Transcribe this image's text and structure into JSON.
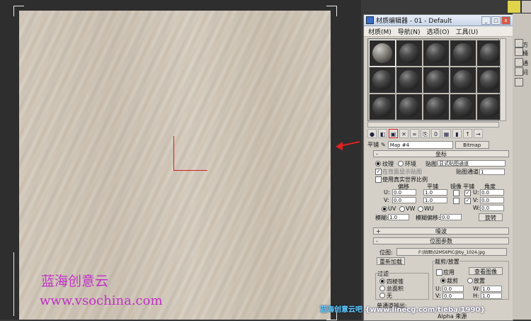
{
  "viewport": {},
  "watermark": {
    "line1": "蓝海创意云",
    "line2": "www.vsochina.com"
  },
  "credit": {
    "text": "蓝海创意云吧",
    "url": "{www.linecg.com/tieba/1990}"
  },
  "window": {
    "title": "材质编辑器 - 01 - Default",
    "minimize": "_",
    "maximize": "□",
    "close": "x"
  },
  "menu": [
    "材质(M)",
    "导航(N)",
    "选项(O)",
    "工具(U)"
  ],
  "toolbar": {
    "icons": [
      "get-material",
      "put-to-scene",
      "assign-to-selection",
      "reset",
      "make-unique",
      "put-library",
      "material-id",
      "show-map",
      "show-end-result",
      "go-parent",
      "go-sibling"
    ],
    "delete_glyph": "✕"
  },
  "map_row": {
    "label": "平铺",
    "map_name": "Map #4",
    "type_button": "Bitmap"
  },
  "coords": {
    "header": "坐标",
    "texture": "纹理",
    "environ": "环境",
    "mapping_label": "贴图:",
    "mapping_value": "显式贴图通道",
    "show_map_back": "在背面显示贴图",
    "map_channel_label": "贴图通道:",
    "map_channel_value": "1",
    "real_world": "使用真实世界比例",
    "offset": "偏移",
    "tiling": "平铺",
    "mirror": "镜像",
    "tile": "平铺",
    "angle": "角度",
    "u_label": "U:",
    "v_label": "V:",
    "w_label": "W:",
    "u_offset": "0.0",
    "v_offset": "0.0",
    "u_tiling": "1.0",
    "v_tiling": "1.0",
    "u_angle": "0.0",
    "v_angle": "0.0",
    "w_angle": "0.0",
    "uv": "UV",
    "vw": "VW",
    "wu": "WU",
    "blur_label": "模糊:",
    "blur_value": "1.0",
    "blur_offset_label": "模糊偏移:",
    "blur_offset_value": "0.0",
    "rotate": "旋转"
  },
  "noise": {
    "header": "噪波"
  },
  "bitmap_params": {
    "header": "位图参数",
    "bitmap_label": "位图:",
    "bitmap_path": "F:\\贴图\\02M56PIC@by_1024.jpg",
    "reload": "重新加载",
    "crop_group": "裁剪/放置",
    "apply": "应用",
    "view_image": "查看图像",
    "crop": "裁剪",
    "place": "放置",
    "filter_group": "过滤",
    "pyramidal": "四棱锥",
    "summed_area": "总面积",
    "none": "无",
    "u_label": "U:",
    "v_label": "V:",
    "w_label": "W:",
    "h_label": "H:",
    "u_value": "0.0",
    "v_value": "0.0",
    "w_value": "1.0",
    "h_value": "1.0",
    "mono_output": "单通道输出:",
    "alpha_group": "Alpha 来源"
  },
  "right_strip": {
    "labels": [
      "方",
      "桶",
      "通",
      "间"
    ]
  }
}
